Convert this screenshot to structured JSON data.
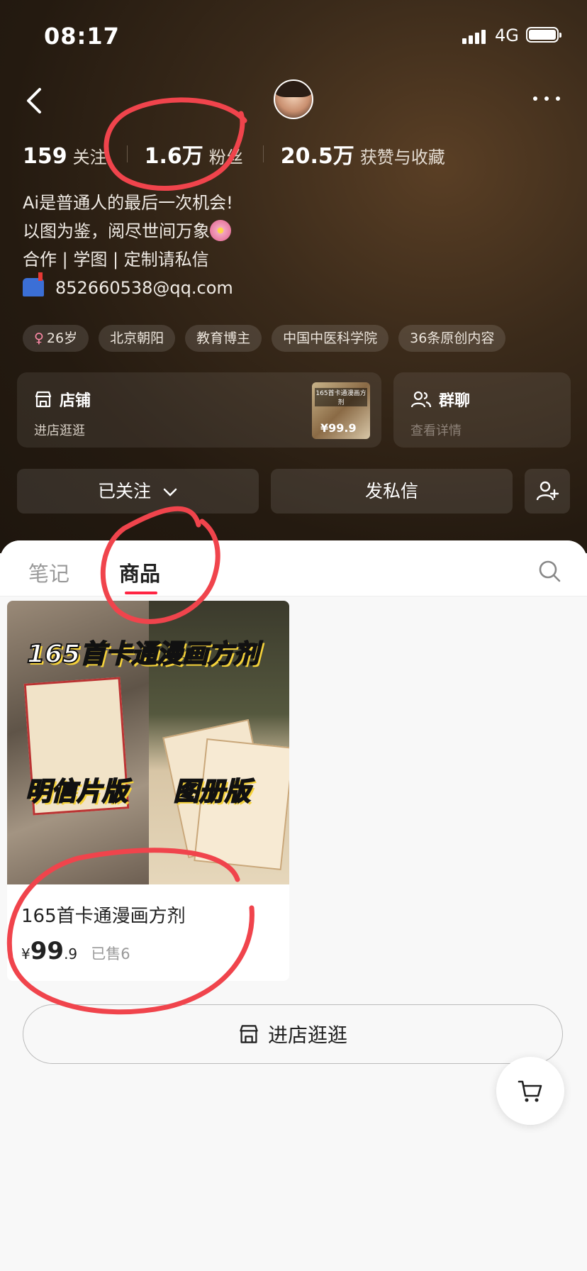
{
  "status_bar": {
    "time": "08:17",
    "network": "4G"
  },
  "header": {
    "avatar_alt": "avatar"
  },
  "stats": [
    {
      "value": "159",
      "label": "关注"
    },
    {
      "value": "1.6万",
      "label": "粉丝"
    },
    {
      "value": "20.5万",
      "label": "获赞与收藏"
    }
  ],
  "bio": {
    "line1": "Ai是普通人的最后一次机会!",
    "line2": "以图为鉴，阅尽世间万象",
    "line3": " 合作 | 学图 | 定制请私信",
    "email": "852660538@qq.com"
  },
  "tags": [
    {
      "label": "26岁",
      "icon": "female-icon"
    },
    {
      "label": "北京朝阳"
    },
    {
      "label": "教育博主"
    },
    {
      "label": "中国中医科学院"
    },
    {
      "label": "36条原创内容"
    }
  ],
  "shop_card": {
    "title": "店铺",
    "subtitle": "进店逛逛",
    "thumb_title": "165首卡通漫画方剂",
    "thumb_price": "¥99.9"
  },
  "group_card": {
    "title": "群聊",
    "subtitle": "查看详情"
  },
  "actions": {
    "follow": "已关注",
    "message": "发私信"
  },
  "tabs": [
    {
      "label": "笔记"
    },
    {
      "label": "商品",
      "active": true
    }
  ],
  "product": {
    "banner": "165首卡通漫画方剂",
    "badge_left": "明信片版",
    "badge_right": "图册版",
    "name": "165首卡通漫画方剂",
    "currency": "¥",
    "price_int": "99",
    "price_dec": ".9",
    "sold": "已售6"
  },
  "shop_button": {
    "label": "进店逛逛"
  },
  "colors": {
    "accent": "#ff2442",
    "annotation": "#f0444c"
  }
}
